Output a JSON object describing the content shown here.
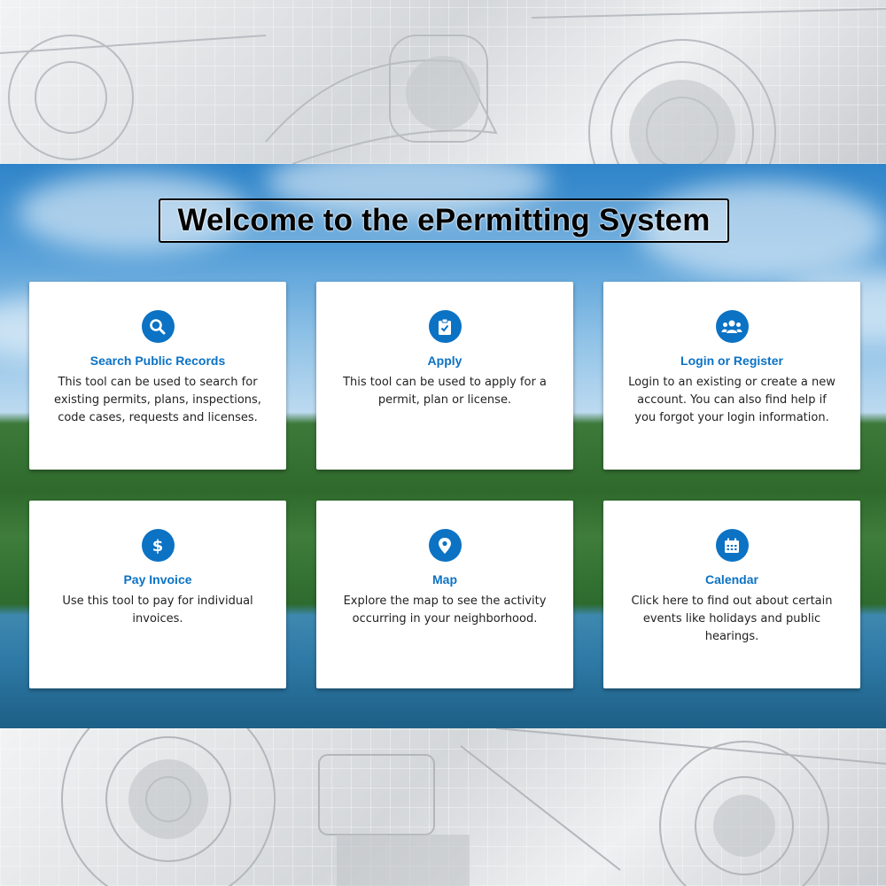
{
  "header": {
    "title": "Welcome to the ePermitting System"
  },
  "colors": {
    "accent": "#0b72c4",
    "card_bg": "#ffffff",
    "title_text": "#000000"
  },
  "cards": [
    {
      "title": "Search Public Records",
      "description": "This tool can be used to search for existing permits, plans, inspections, code cases, requests and licenses.",
      "icon": "search-icon"
    },
    {
      "title": "Apply",
      "description": "This tool can be used to apply for a permit, plan or license.",
      "icon": "clipboard-check-icon"
    },
    {
      "title": "Login or Register",
      "description": "Login to an existing or create a new account. You can also find help if you forgot your login information.",
      "icon": "users-icon"
    },
    {
      "title": "Pay Invoice",
      "description": "Use this tool to pay for individual invoices.",
      "icon": "dollar-icon"
    },
    {
      "title": "Map",
      "description": "Explore the map to see the activity occurring in your neighborhood.",
      "icon": "map-pin-icon"
    },
    {
      "title": "Calendar",
      "description": "Click here to find out about certain events like holidays and public hearings.",
      "icon": "calendar-icon"
    }
  ]
}
